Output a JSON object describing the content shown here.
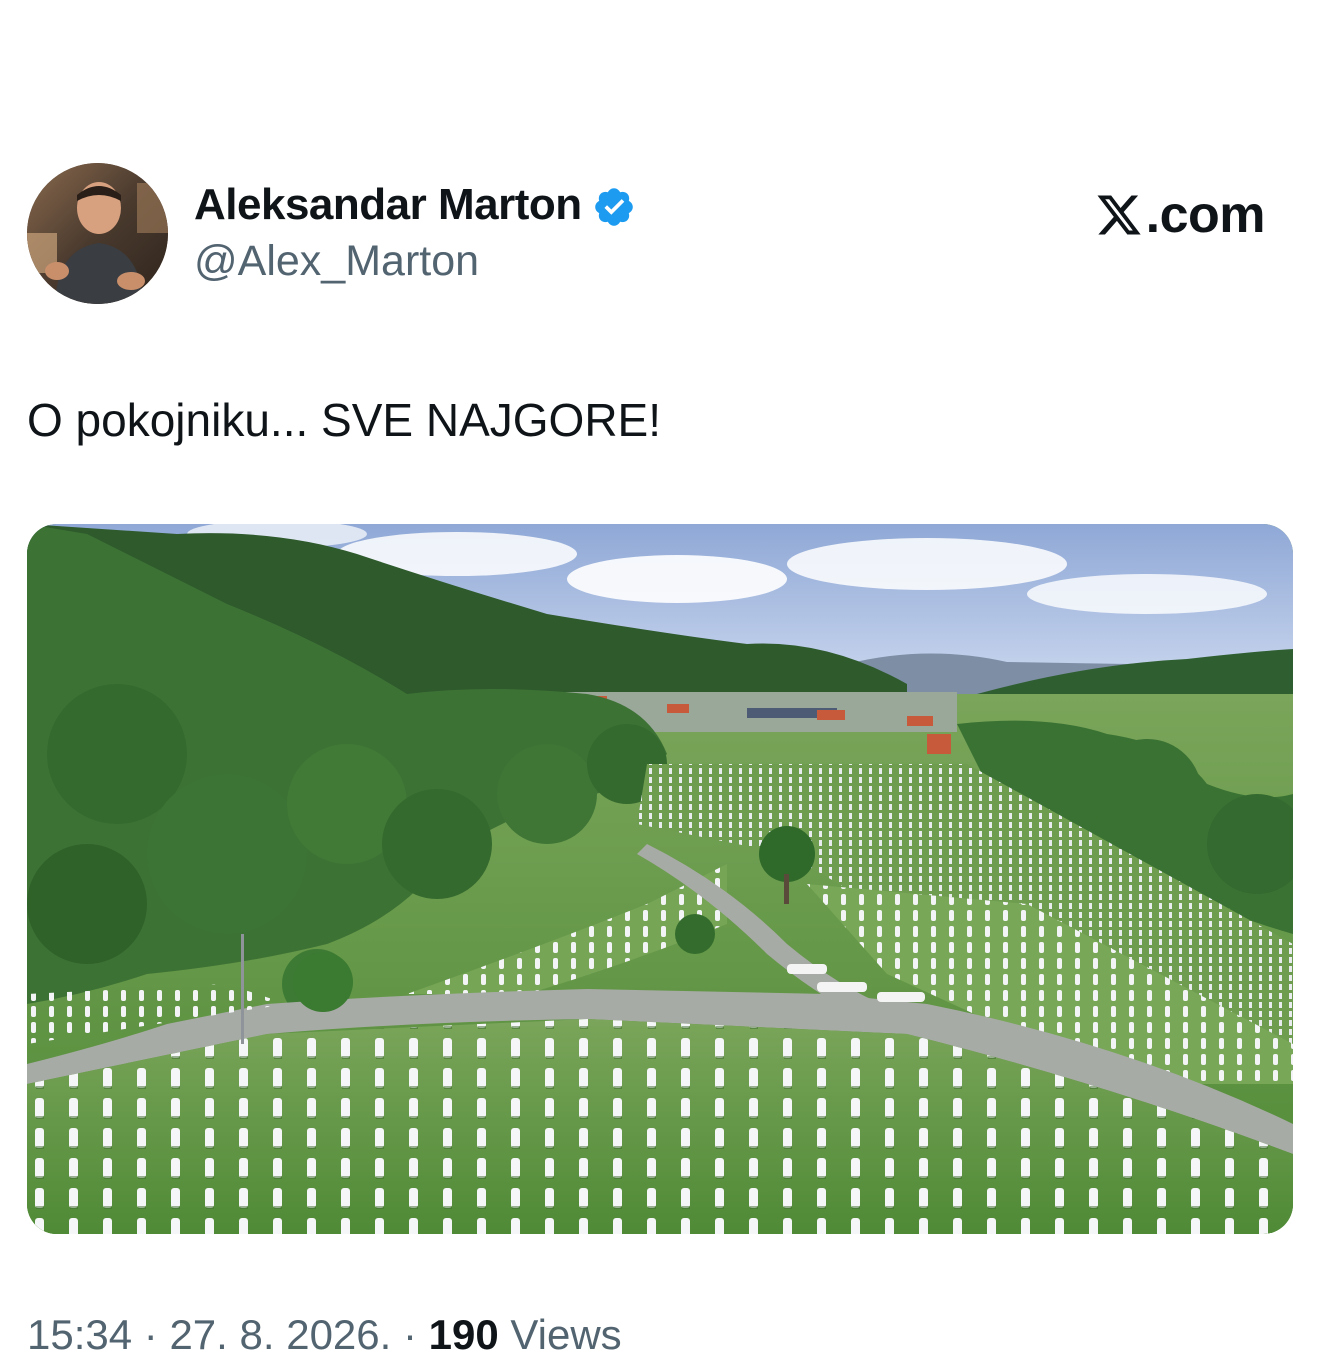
{
  "author": {
    "display_name": "Aleksandar Marton",
    "handle": "@Alex_Marton",
    "verified": true,
    "verified_color": "#1d9bf0"
  },
  "brand": {
    "label": ".com",
    "logo_icon": "x-logo-icon"
  },
  "tweet": {
    "text": "O pokojniku... SVE NAJGORE!",
    "image_description_icon": "photo"
  },
  "meta": {
    "time": "15:34",
    "separator": "·",
    "date": "27. 8. 2026.",
    "views_count": "190",
    "views_label": "Views"
  },
  "colors": {
    "text_primary": "#0f1419",
    "text_secondary": "#536471",
    "accent": "#1d9bf0"
  }
}
